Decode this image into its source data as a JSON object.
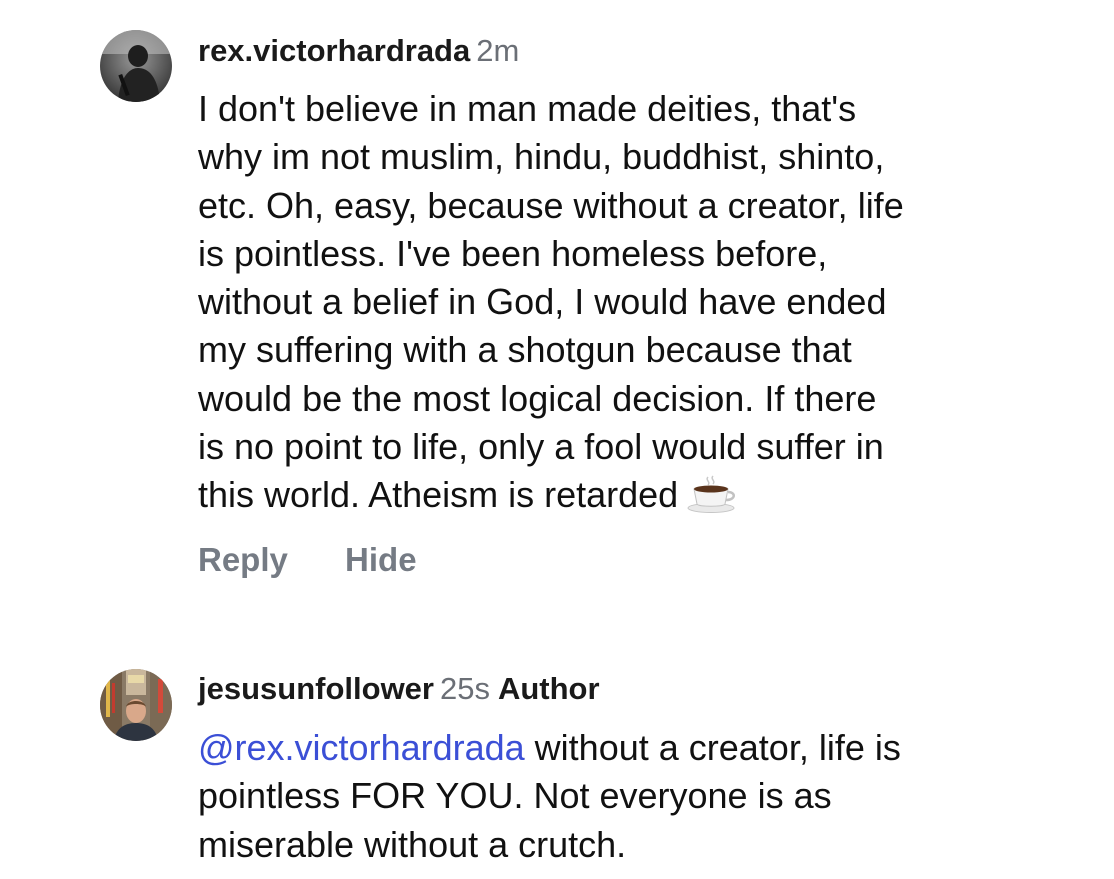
{
  "comments": [
    {
      "username": "rex.victorhardrada",
      "time": "2m",
      "lines": [
        "I don't believe in man made deities, that's",
        "why im not muslim, hindu, buddhist, shinto,",
        "etc. Oh, easy, because without a creator, life",
        "is pointless. I've been homeless before,",
        "without a belief in God, I would have ended",
        "my suffering with a shotgun because that",
        "would be the most logical decision. If there",
        "is no point to life, only a fool would suffer in",
        "this world. Atheism is retarded"
      ],
      "emoji": "coffee-icon",
      "actions": {
        "reply": "Reply",
        "hide": "Hide"
      }
    },
    {
      "username": "jesusunfollower",
      "time": "25s",
      "badge": "Author",
      "mention": "@rex.victorhardrada",
      "lines": [
        " without a creator, life is",
        "pointless FOR YOU. Not everyone is as",
        "miserable without a crutch."
      ]
    }
  ],
  "colors": {
    "text": "#111111",
    "meta": "#6b6f76",
    "action": "#757b84",
    "mention": "#3b4fd6"
  }
}
